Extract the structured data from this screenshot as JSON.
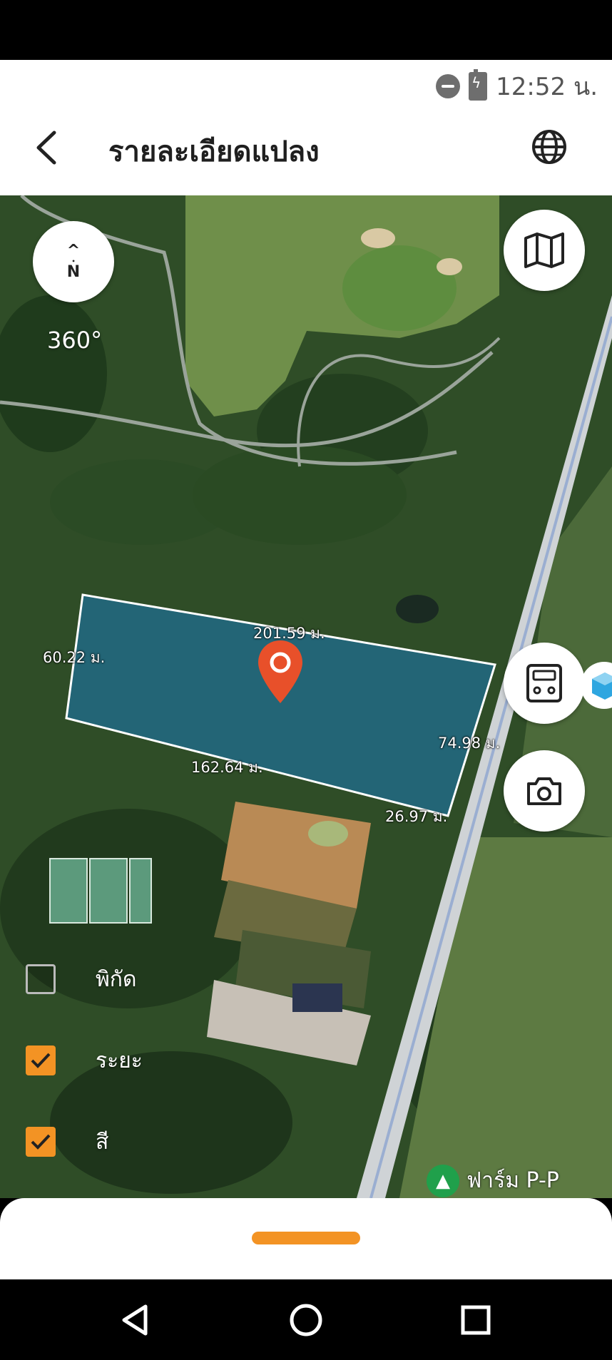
{
  "status_bar": {
    "time": "12:52 น."
  },
  "header": {
    "title": "รายละเอียดแปลง"
  },
  "map": {
    "compass_letter": "N",
    "compass_arrow": "^",
    "heading": "360°",
    "distances": {
      "top": "201.59 ม.",
      "left": "60.22 ม.",
      "bottom": "162.64 ม.",
      "right": "74.98 ม.",
      "bottom_right": "26.97 ม."
    },
    "poi_label": "ฟาร์ม P-P",
    "parcel_color": "#1f6f95",
    "marker_color": "#e8502a"
  },
  "layers": [
    {
      "label": "พิกัด",
      "checked": false
    },
    {
      "label": "ระยะ",
      "checked": true
    },
    {
      "label": "สี",
      "checked": true
    }
  ],
  "colors": {
    "accent": "#f39324"
  },
  "icons": {
    "back": "back-arrow-icon",
    "globe": "globe-icon",
    "map": "map-icon",
    "calculator": "calculator-icon",
    "camera": "camera-icon"
  }
}
